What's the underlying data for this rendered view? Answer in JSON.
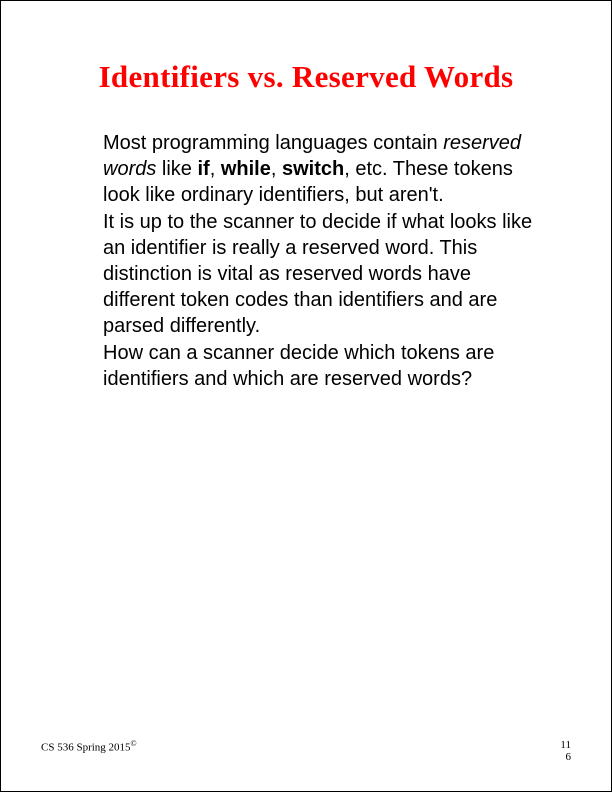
{
  "slide": {
    "title": "Identifiers vs. Reserved Words",
    "p1_pre": "Most programming languages contain ",
    "p1_italic": "reserved words",
    "p1_mid1": " like ",
    "p1_bold1": "if",
    "p1_mid2": ", ",
    "p1_bold2": "while",
    "p1_mid3": ", ",
    "p1_bold3": "switch",
    "p1_post": ", etc. These tokens look like ordinary identifiers, but aren't.",
    "p2": "It is up to the scanner to decide if what looks like an identifier is really a reserved word. This distinction is vital as reserved words have different token codes than identifiers and are parsed differently.",
    "p3": "How can a scanner decide which tokens are identifiers and which are reserved words?"
  },
  "footer": {
    "course": "CS 536  Spring 2015",
    "copyright": "©",
    "page_top": "11",
    "page_bottom": "6"
  }
}
